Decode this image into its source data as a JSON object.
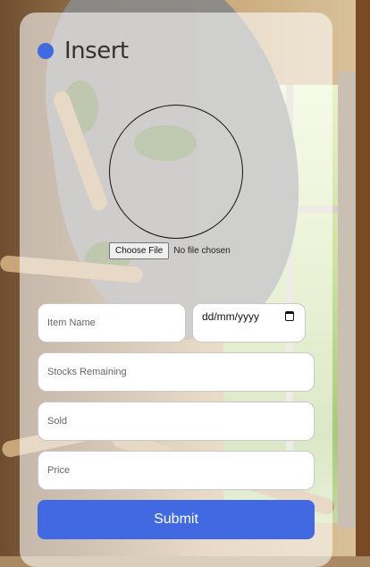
{
  "header": {
    "title": "Insert"
  },
  "file_input": {
    "button_label": "Choose File",
    "status": "No file chosen"
  },
  "fields": {
    "item_name": {
      "placeholder": "Item Name"
    },
    "date": {
      "value": "dd/mm/yyyy"
    },
    "stocks": {
      "placeholder": "Stocks Remaining"
    },
    "sold": {
      "placeholder": "Sold"
    },
    "price": {
      "placeholder": "Price"
    }
  },
  "submit_label": "Submit",
  "colors": {
    "accent": "#4169e1"
  },
  "icons": {
    "date_picker": "calendar-icon",
    "header_dot": "status-dot"
  }
}
